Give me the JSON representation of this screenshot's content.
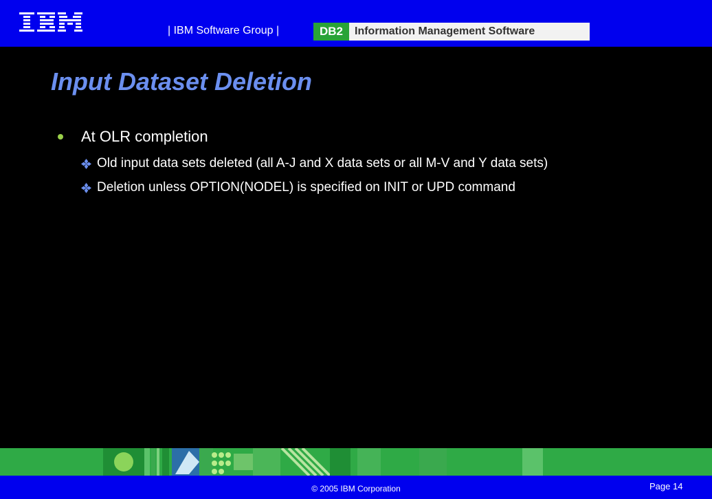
{
  "header": {
    "logo_text": "IBM",
    "group_text": "| IBM Software Group |",
    "db2_label": "DB2",
    "product_label": "Information Management Software"
  },
  "slide": {
    "title": "Input Dataset Deletion",
    "bullet": "At OLR completion",
    "sub_bullets": [
      "Old input data sets deleted (all A-J and X data sets or all M-V and Y data sets)",
      "Deletion unless OPTION(NODEL) is specified on INIT or UPD command"
    ]
  },
  "footer": {
    "copyright": "© 2005 IBM Corporation",
    "page": "Page 14"
  },
  "colors": {
    "header_blue": "#0000ee",
    "title_blue": "#6b8fef",
    "db2_green": "#29a337",
    "band_green": "#2faa46"
  }
}
